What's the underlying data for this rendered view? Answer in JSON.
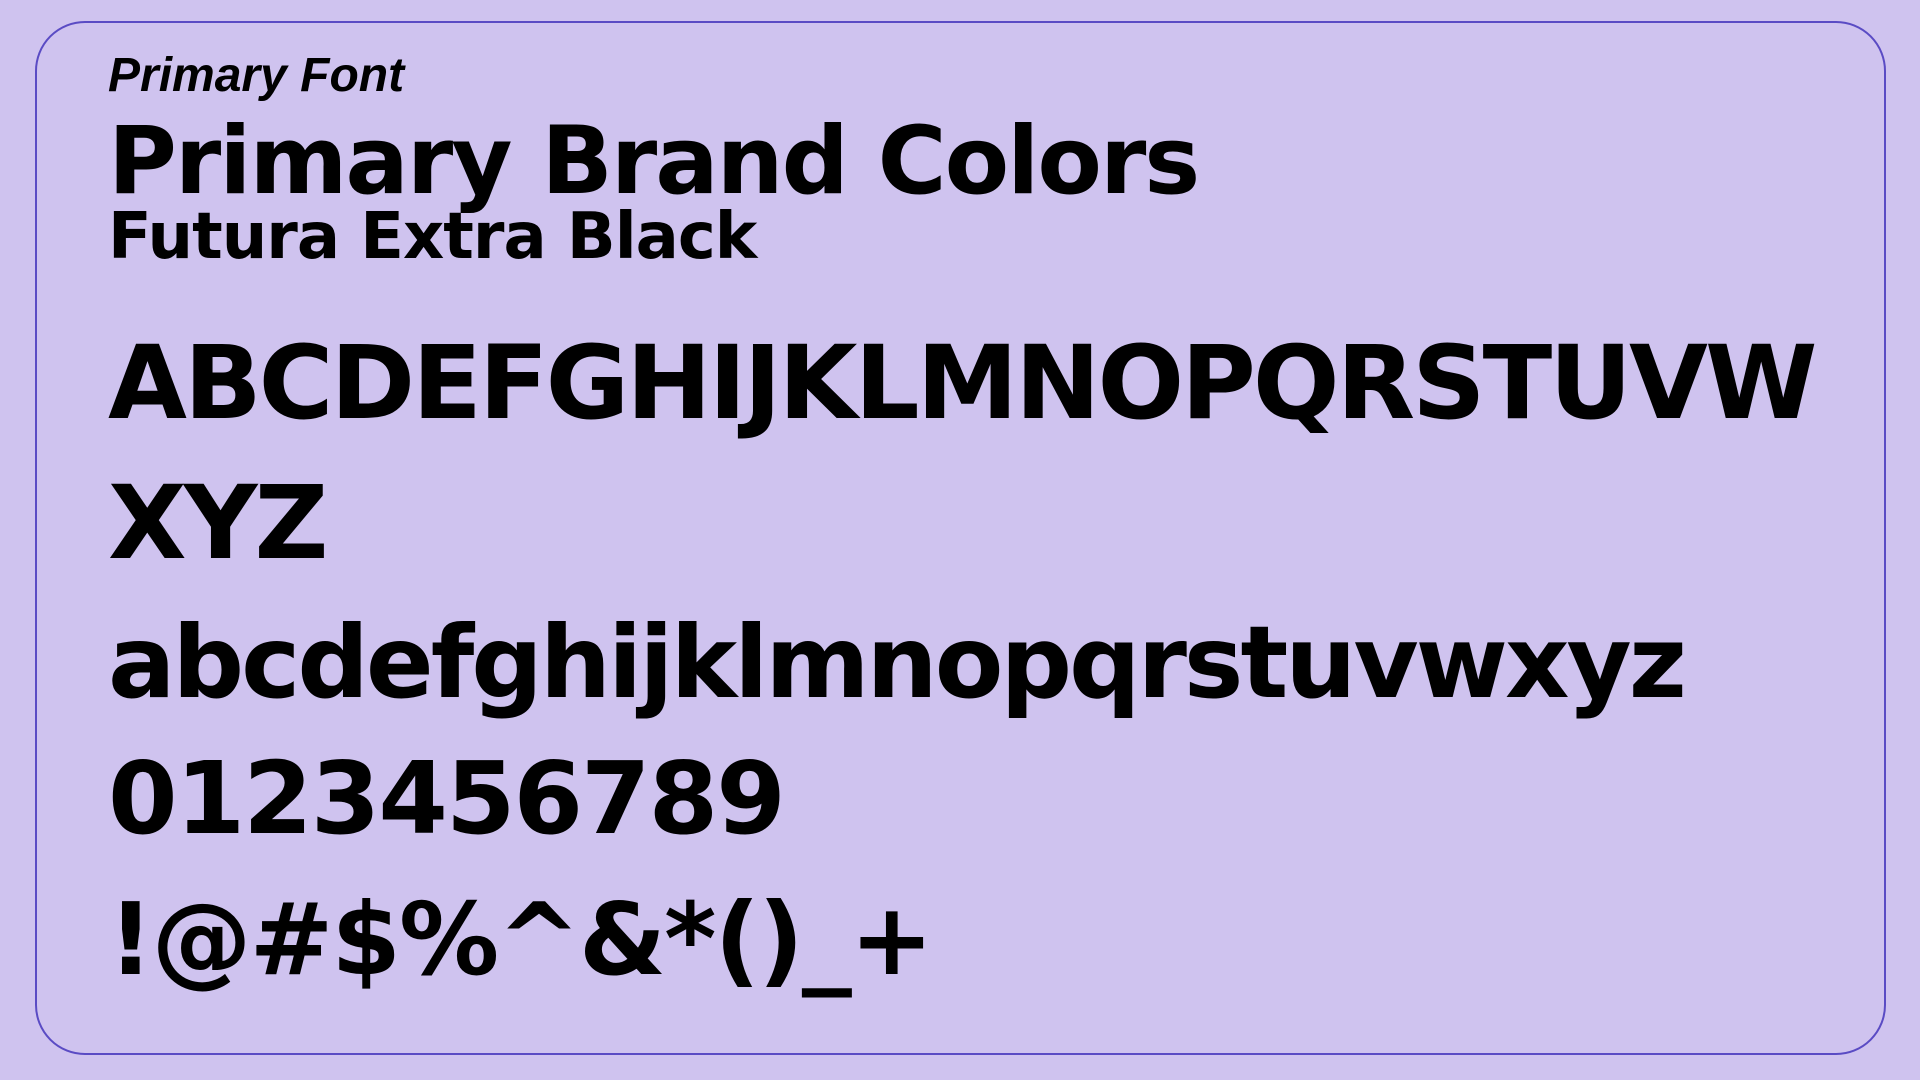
{
  "panel": {
    "label": "Primary Font",
    "title": "Primary Brand Colors",
    "font_name": "Futura Extra Black"
  },
  "specimen": {
    "uppercase": "ABCDEFGHIJKLMNOPQRSTUVWXYZ",
    "lowercase": "abcdefghijklmnopqrstuvwxyz",
    "digits": "0123456789",
    "symbols": "!@#$%^&*()_+"
  },
  "colors": {
    "background": "#cfc3ef",
    "border": "#5a4bc4",
    "text": "#000000"
  }
}
